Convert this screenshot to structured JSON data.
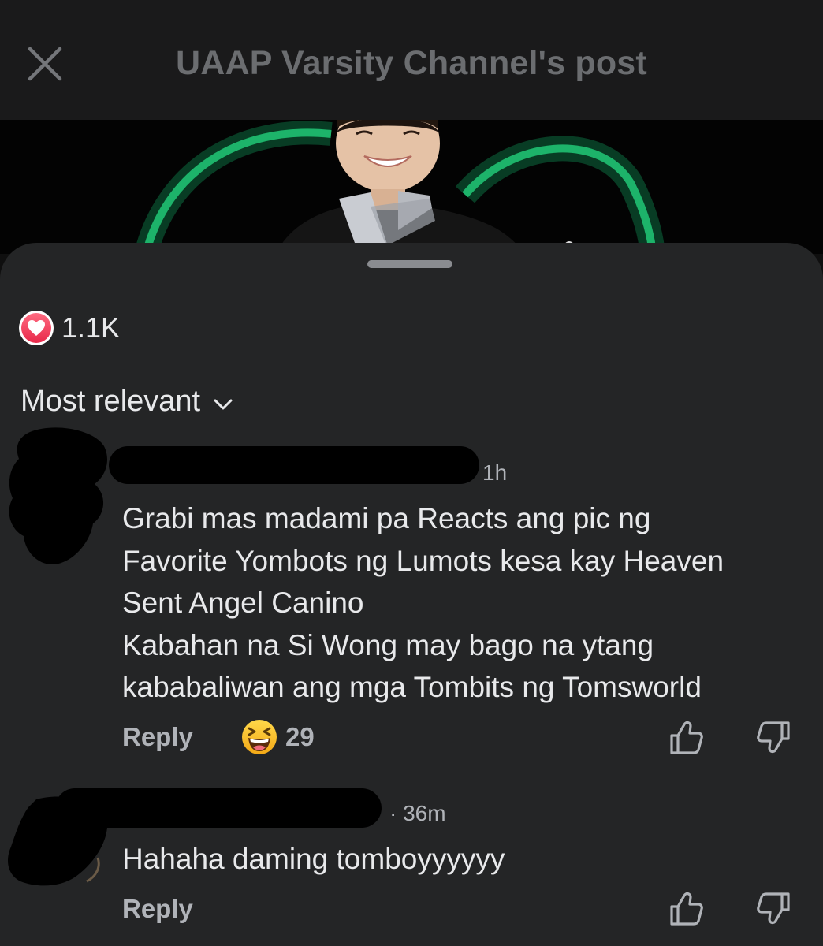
{
  "header": {
    "title": "UAAP Varsity Channel's post",
    "close_icon": "close-icon"
  },
  "post": {
    "reaction_icon": "love-reaction-icon",
    "reaction_count": "1.1K",
    "sort_label": "Most relevant",
    "sort_icon": "chevron-down-icon"
  },
  "comments": [
    {
      "time": "1h",
      "text": "Grabi mas madami pa Reacts ang pic ng\nFavorite Yombots ng Lumots kesa kay Heaven\nSent Angel Canino\nKabahan na Si Wong may bago na ytang\nkababaliwan ang mga Tombits ng Tomsworld",
      "reply_label": "Reply",
      "reaction_icon": "grinning-squinting-face-icon",
      "reaction_count": "29",
      "like_icon": "thumbs-up-icon",
      "dislike_icon": "thumbs-down-icon"
    },
    {
      "time": "· 36m",
      "text": "Hahaha daming tomboyyyyyy",
      "reply_label": "Reply",
      "like_icon": "thumbs-up-icon",
      "dislike_icon": "thumbs-down-icon"
    }
  ],
  "colors": {
    "sheet": "#242526",
    "topbar": "#1a1a1b",
    "text_primary": "#e8e9eb",
    "text_secondary": "#b0b3b8",
    "love": "#e8294a",
    "accent_green": "#1db36a"
  }
}
